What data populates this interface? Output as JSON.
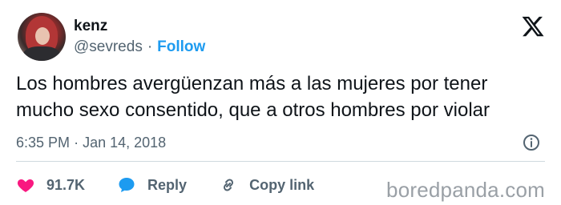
{
  "author": {
    "name": "kenz",
    "handle": "@sevreds",
    "separator": "·",
    "follow_label": "Follow"
  },
  "tweet": {
    "text_line1": "Los hombres avergüenzan más a las mujeres por tener",
    "text_line2": "mucho sexo consentido, que a otros hombres por violar",
    "time": "6:35 PM",
    "date_separator": "·",
    "date": "Jan 14, 2018"
  },
  "actions": {
    "likes": "91.7K",
    "reply_label": "Reply",
    "copy_link_label": "Copy link"
  },
  "watermark": "boredpanda.com",
  "colors": {
    "accent": "#1d9bf0",
    "like": "#f91880",
    "muted": "#536471",
    "text": "#0f1419"
  },
  "icons": [
    "x-logo-icon",
    "info-icon",
    "heart-icon",
    "reply-bubble-icon",
    "link-icon"
  ]
}
